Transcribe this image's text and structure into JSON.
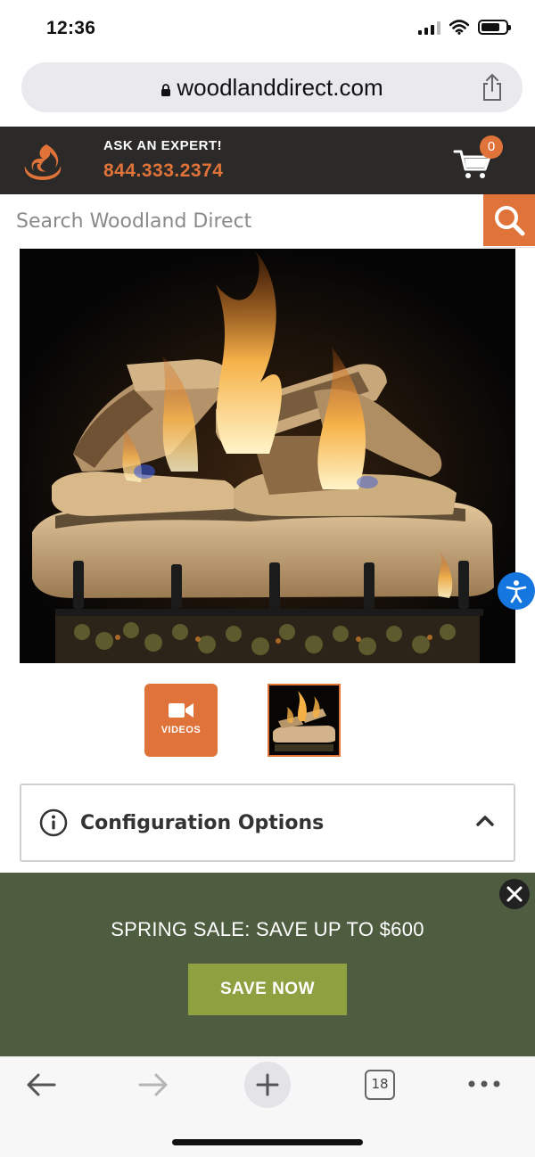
{
  "status_bar": {
    "time": "12:36"
  },
  "browser": {
    "url": "woodlanddirect.com",
    "open_tabs_count": "18"
  },
  "header": {
    "ask_expert": "ASK AN EXPERT!",
    "phone": "844.333.2374",
    "cart_count": "0"
  },
  "search": {
    "placeholder": "Search Woodland Direct"
  },
  "gallery": {
    "videos_label": "VIDEOS"
  },
  "config": {
    "title": "Configuration Options"
  },
  "sale": {
    "text": "SPRING SALE: SAVE UP TO $600",
    "button": "SAVE NOW"
  },
  "colors": {
    "brand_orange": "#e0733a",
    "header_dark": "#2b2a28",
    "banner_green": "#4e5d3f",
    "button_green": "#8ea03f"
  },
  "icons": [
    "lock-icon",
    "share-icon",
    "flame-logo-icon",
    "cart-icon",
    "search-icon",
    "accessibility-icon",
    "video-camera-icon",
    "info-icon",
    "chevron-up-icon",
    "close-icon",
    "back-arrow-icon",
    "forward-arrow-icon",
    "plus-icon",
    "more-dots-icon"
  ]
}
